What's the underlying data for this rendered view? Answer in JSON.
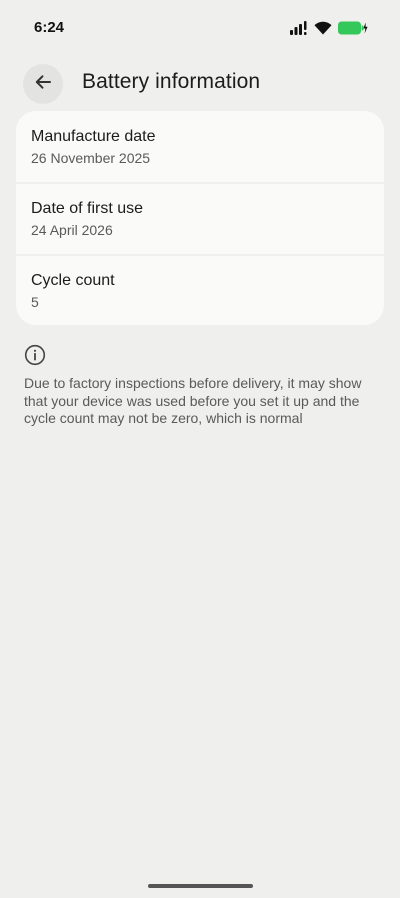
{
  "status_bar": {
    "time": "6:24",
    "icons": [
      "signal-icon",
      "wifi-icon",
      "battery-charging-icon"
    ],
    "battery_color": "#34c759"
  },
  "header": {
    "back_icon": "arrow-left-icon",
    "title": "Battery information"
  },
  "battery_info": {
    "rows": [
      {
        "label": "Manufacture date",
        "value": "26 November 2025"
      },
      {
        "label": "Date of first use",
        "value": "24 April 2026"
      },
      {
        "label": "Cycle count",
        "value": "5"
      }
    ]
  },
  "note": {
    "icon": "info-icon",
    "text": "Due to factory inspections before delivery, it may show that your device was used before you set it up and the cycle count may not be zero, which is normal"
  }
}
